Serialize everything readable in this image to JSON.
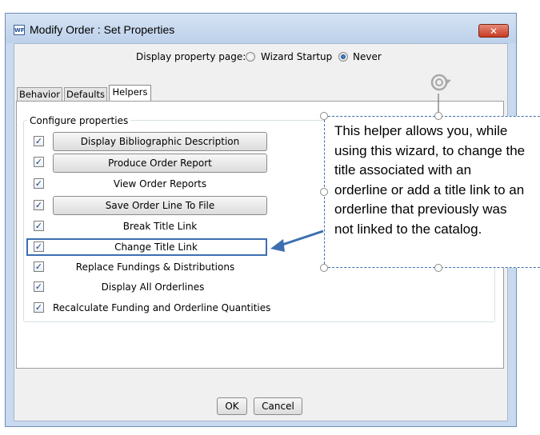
{
  "window": {
    "icon_text": "WF",
    "title": "Modify Order :  Set Properties",
    "close_glyph": "✕"
  },
  "display_property_page": {
    "label": "Display property page:",
    "options": [
      "Wizard Startup",
      "Never"
    ],
    "selected": "Never"
  },
  "tabs": [
    {
      "label": "Behavior",
      "active": false
    },
    {
      "label": "Defaults",
      "active": false
    },
    {
      "label": "Helpers",
      "active": true
    }
  ],
  "configure": {
    "label": "Configure properties",
    "items": [
      {
        "label": "Display Bibliographic Description",
        "checked": true,
        "is_button": true
      },
      {
        "label": "Produce Order Report",
        "checked": true,
        "is_button": true
      },
      {
        "label": "View Order Reports",
        "checked": true,
        "is_button": false
      },
      {
        "label": "Save Order Line To File",
        "checked": true,
        "is_button": true
      },
      {
        "label": "Break Title Link",
        "checked": true,
        "is_button": false
      },
      {
        "label": "Change Title Link",
        "checked": true,
        "is_button": false
      },
      {
        "label": "Replace Fundings & Distributions",
        "checked": true,
        "is_button": false
      },
      {
        "label": "Display All Orderlines",
        "checked": true,
        "is_button": false
      },
      {
        "label": "Recalculate Funding and Orderline Quantities",
        "checked": true,
        "is_button": false
      }
    ]
  },
  "callout": {
    "lines": [
      "This helper allows you, while",
      "using this wizard, to change the",
      "title associated with an",
      "orderline or add a title link to an",
      "orderline that previously was",
      "not linked to the catalog."
    ]
  },
  "footer": {
    "ok_label": "OK",
    "cancel_label": "Cancel"
  },
  "colors": {
    "callout_border": "#3c6fb0",
    "highlight": "#3c6fb0",
    "close_button": "#c73b22"
  },
  "icons": {
    "rotate": "rotate-icon",
    "check": "✓"
  }
}
